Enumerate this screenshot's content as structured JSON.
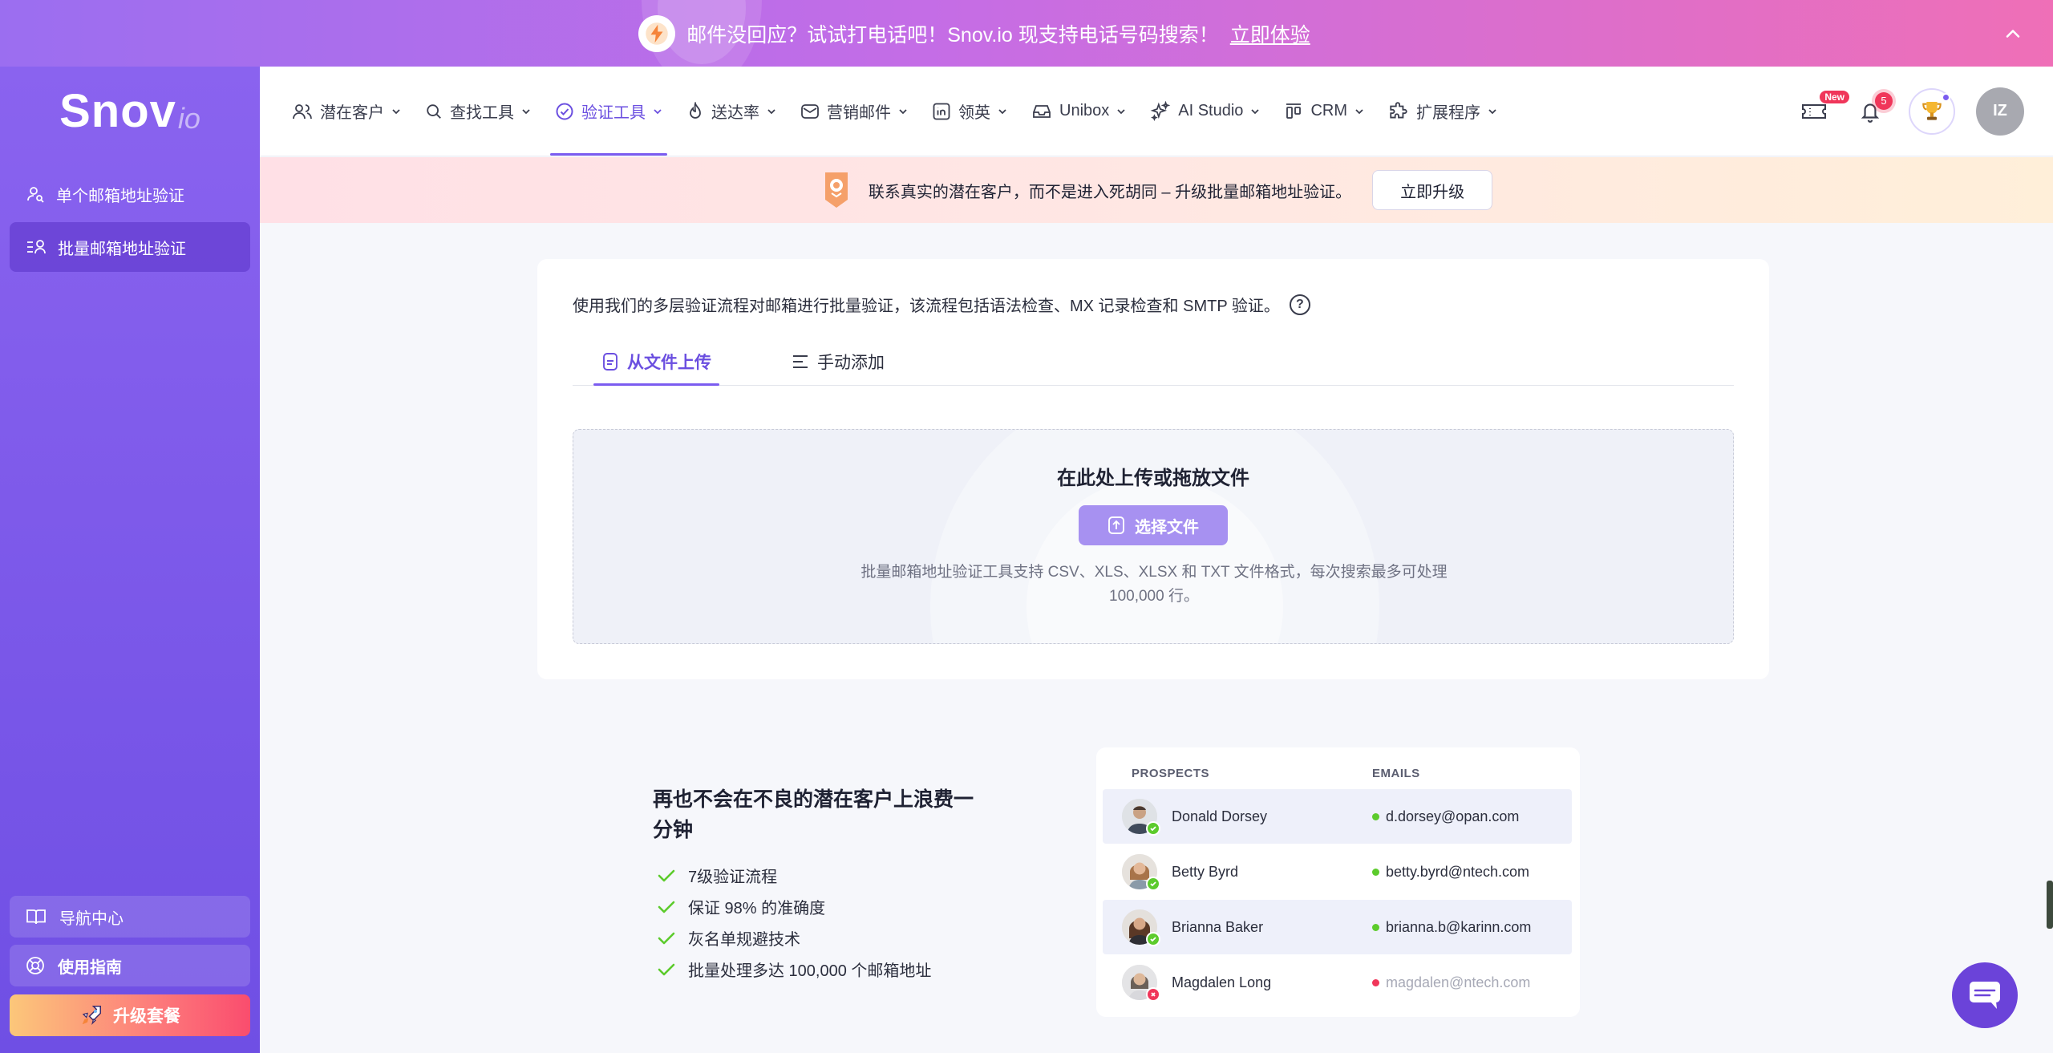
{
  "promo": {
    "text": "邮件没回应？试试打电话吧！Snov.io 现支持电话号码搜索！",
    "link": "立即体验"
  },
  "logo": {
    "main": "Snov",
    "suffix": "io"
  },
  "sidebar": {
    "items": [
      {
        "label": "单个邮箱地址验证"
      },
      {
        "label": "批量邮箱地址验证"
      }
    ],
    "nav_center": "导航中心",
    "guide": "使用指南",
    "upgrade": "升级套餐"
  },
  "nav": {
    "items": [
      {
        "label": "潜在客户"
      },
      {
        "label": "查找工具"
      },
      {
        "label": "验证工具"
      },
      {
        "label": "送达率"
      },
      {
        "label": "营销邮件"
      },
      {
        "label": "领英"
      },
      {
        "label": "Unibox"
      },
      {
        "label": "AI Studio"
      },
      {
        "label": "CRM"
      },
      {
        "label": "扩展程序"
      }
    ],
    "badge_new": "New",
    "notif_count": "5",
    "avatar_initials": "IZ"
  },
  "banner": {
    "text": "联系真实的潜在客户，而不是进入死胡同 – 升级批量邮箱地址验证。",
    "button": "立即升级"
  },
  "card": {
    "description": "使用我们的多层验证流程对邮箱进行批量验证，该流程包括语法检查、MX 记录检查和 SMTP 验证。",
    "help": "?",
    "tabs": [
      {
        "label": "从文件上传"
      },
      {
        "label": "手动添加"
      }
    ],
    "upload_title": "在此处上传或拖放文件",
    "choose_button": "选择文件",
    "upload_info": "批量邮箱地址验证工具支持 CSV、XLS、XLSX 和 TXT 文件格式，每次搜索最多可处理 100,000 行。"
  },
  "features": {
    "title": "再也不会在不良的潜在客户上浪费一分钟",
    "items": [
      {
        "label": "7级验证流程"
      },
      {
        "label": "保证 98% 的准确度"
      },
      {
        "label": "灰名单规避技术"
      },
      {
        "label": "批量处理多达 100,000 个邮箱地址"
      }
    ]
  },
  "prospects": {
    "col_prospects": "PROSPECTS",
    "col_emails": "EMAILS",
    "rows": [
      {
        "name": "Donald Dorsey",
        "email": "d.dorsey@opan.com",
        "valid": true
      },
      {
        "name": "Betty Byrd",
        "email": "betty.byrd@ntech.com",
        "valid": true
      },
      {
        "name": "Brianna Baker",
        "email": "brianna.b@karinn.com",
        "valid": true
      },
      {
        "name": "Magdalen Long",
        "email": "magdalen@ntech.com",
        "valid": false
      }
    ]
  },
  "colors": {
    "accent": "#7b5cf0",
    "valid": "#5ccb2c",
    "invalid": "#f0365a"
  }
}
